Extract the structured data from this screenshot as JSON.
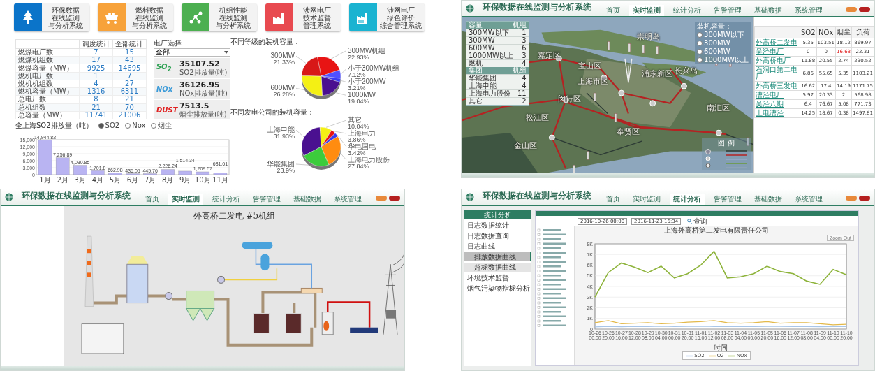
{
  "launcher": {
    "tiles": [
      {
        "lines": [
          "环保数据",
          "在线监测",
          "与分析系统"
        ],
        "color": "#0b74c9"
      },
      {
        "lines": [
          "燃料数据",
          "在线监测",
          "与分析系统"
        ],
        "color": "#f7a23a"
      },
      {
        "lines": [
          "机组性能",
          "在线监测",
          "与分析系统"
        ],
        "color": "#4caf50"
      },
      {
        "lines": [
          "涉网电厂",
          "技术监督",
          "管理系统"
        ],
        "color": "#e84a50"
      },
      {
        "lines": [
          "涉网电厂",
          "绿色评价",
          "综合管理系统"
        ],
        "color": "#1ab3d1"
      }
    ]
  },
  "overview": {
    "table": {
      "columns": [
        "调度统计",
        "全部统计"
      ],
      "rows": [
        {
          "label": "燃煤电厂数",
          "values": [
            "7",
            "15"
          ]
        },
        {
          "label": "燃煤机组数",
          "values": [
            "17",
            "43"
          ]
        },
        {
          "label": "燃煤容量（MW）",
          "values": [
            "9925",
            "14695"
          ]
        },
        {
          "label": "燃机电厂数",
          "values": [
            "1",
            "7"
          ]
        },
        {
          "label": "燃机机组数",
          "values": [
            "4",
            "27"
          ]
        },
        {
          "label": "燃机容量（MW）",
          "values": [
            "1316",
            "6311"
          ]
        },
        {
          "label": "总电厂数",
          "values": [
            "8",
            "21"
          ]
        },
        {
          "label": "总机组数",
          "values": [
            "21",
            "70"
          ]
        },
        {
          "label": "总容量（MW）",
          "values": [
            "11741",
            "21006"
          ]
        }
      ]
    },
    "plant_select": {
      "label": "电厂选择",
      "value": "全部"
    },
    "emissions": [
      {
        "kind": "so2",
        "badge": "SO$_{2}$",
        "value": "35107.52",
        "caption": "SO2排放量(吨)"
      },
      {
        "kind": "nox",
        "badge": "NOx",
        "value": "36126.95",
        "caption": "NOx排放量(吨)"
      },
      {
        "kind": "dust",
        "badge": "DUST",
        "value": "7513.5",
        "caption": "烟尘排放量(吨)"
      }
    ],
    "bar_chart": {
      "legend": [
        {
          "label": "SO2",
          "selected": true
        },
        {
          "label": "Nox",
          "selected": false
        },
        {
          "label": "烟尘",
          "selected": false
        }
      ],
      "chart_data": {
        "type": "bar",
        "title": "全上海SO2排放量（吨）",
        "categories": [
          "1月",
          "2月",
          "3月",
          "4月",
          "5月",
          "6月",
          "7月",
          "8月",
          "9月",
          "10月",
          "11月"
        ],
        "series": [
          {
            "color": "#b9b4f2",
            "values": [
              14944.82,
              7256.89,
              4030.85,
              1701.8,
              662.98,
              436.05,
              445.76,
              2226.24,
              1514.34,
              1209.57,
              681.61
            ]
          }
        ],
        "grid": true,
        "ylim": [
          0,
          15000
        ],
        "yticks": [
          0,
          {
            "value": 3000,
            "label": "3,000"
          },
          {
            "value": 6000,
            "label": "6,000"
          },
          {
            "value": 9000,
            "label": "9,000"
          },
          {
            "value": 12000,
            "label": "12,000"
          },
          {
            "value": 15000,
            "label": "15,000"
          }
        ],
        "value_labels": [
          "14,944.82",
          "7,256.89",
          "4,030.85",
          "1,701.8",
          "662.98",
          "436.05",
          "445.76",
          "2,226.24",
          "1,514.34",
          "1,209.57",
          "681.61"
        ]
      }
    },
    "pies": [
      {
        "chart_data": {
          "type": "pie",
          "title": "不同等级的装机容量：",
          "categories": [
            "300MW机组",
            "小于300MW机组",
            "小于200MW",
            "1000MW",
            "600MW",
            "300MW"
          ],
          "values": [
            22.93,
            7.12,
            3.21,
            19.04,
            26.28,
            21.33
          ],
          "value_labels": [
            "22.93%",
            "7.12%",
            "3.21%",
            "19.04%",
            "26.28%",
            "21.33%"
          ]
        }
      },
      {
        "chart_data": {
          "type": "pie",
          "title": "不同发电公司的装机容量：",
          "categories": [
            "上海申能",
            "其它",
            "上海电力",
            "华电国电",
            "上海电力股份",
            "华能集团"
          ],
          "values": [
            31.93,
            10.04,
            3.86,
            3.42,
            27.84,
            23.9
          ],
          "value_labels": [
            "31.93%",
            "10.04%",
            "3.86%",
            "3.42%",
            "27.84%",
            "23.9%"
          ]
        }
      }
    ]
  },
  "map_screen": {
    "header": {
      "title": "环保数据在线监测与分析系统",
      "nav": [
        {
          "label": "首页",
          "selected": false
        },
        {
          "label": "实时监测",
          "selected": true
        },
        {
          "label": "统计分析",
          "selected": false
        },
        {
          "label": "告警管理",
          "selected": false
        },
        {
          "label": "基础数据",
          "selected": false
        },
        {
          "label": "系统管理",
          "selected": false
        }
      ]
    },
    "overlay_table": [
      {
        "columns": [
          "容量",
          "机组"
        ],
        "rows": [
          [
            "300MW以下",
            "1"
          ],
          [
            "300MW",
            "3"
          ],
          [
            "600MW",
            "6"
          ],
          [
            "1000MW以上",
            "3"
          ],
          [
            "燃机",
            "4"
          ]
        ]
      },
      {
        "columns": [
          "集团",
          "机组"
        ],
        "rows": [
          [
            "华能集团",
            "4"
          ],
          [
            "上海申能",
            "4"
          ],
          [
            "上海电力股份",
            "11"
          ],
          [
            "其它",
            "2"
          ]
        ]
      }
    ],
    "capacity_legend": {
      "title": "装机容量：",
      "options": [
        {
          "label": "300MW以下",
          "selected": false
        },
        {
          "label": "300MW",
          "selected": false
        },
        {
          "label": "600MW",
          "selected": false
        },
        {
          "label": "1000MW以上",
          "selected": false
        }
      ]
    },
    "labels": [
      "崇明岛",
      "长兴岛",
      "宝山区",
      "嘉定区",
      "上海市区",
      "浦东新区",
      "闵行区",
      "松江区",
      "南汇区",
      "奉贤区",
      "金山区"
    ],
    "legend_title": "图 例",
    "plant_table": {
      "columns": [
        "SO2",
        "NOx",
        "烟尘",
        "负荷"
      ],
      "rows": [
        {
          "name": "外高桥二发电",
          "cells": [
            {
              "text": "5.35",
              "alert": false
            },
            {
              "text": "103.51",
              "alert": false
            },
            {
              "text": "18.12",
              "alert": false
            },
            {
              "text": "869.97",
              "alert": false
            }
          ]
        },
        {
          "name": "吴泾电厂",
          "cells": [
            {
              "text": "0",
              "alert": false
            },
            {
              "text": "0",
              "alert": false
            },
            {
              "text": "16.68",
              "alert": true
            },
            {
              "text": "22.31",
              "alert": false
            }
          ]
        },
        {
          "name": "外高桥电厂",
          "cells": [
            {
              "text": "11.88",
              "alert": false
            },
            {
              "text": "20.55",
              "alert": false
            },
            {
              "text": "2.74",
              "alert": false
            },
            {
              "text": "230.52",
              "alert": false
            }
          ]
        },
        {
          "name": "石洞口第二电厂",
          "cells": [
            {
              "text": "6.86",
              "alert": false
            },
            {
              "text": "55.65",
              "alert": false
            },
            {
              "text": "5.35",
              "alert": false
            },
            {
              "text": "1103.21",
              "alert": false
            }
          ]
        },
        {
          "name": "外高桥三发电",
          "cells": [
            {
              "text": "16.62",
              "alert": false
            },
            {
              "text": "17.4",
              "alert": false
            },
            {
              "text": "14.19",
              "alert": false
            },
            {
              "text": "1171.75",
              "alert": false
            }
          ]
        },
        {
          "name": "漕泾电厂",
          "cells": [
            {
              "text": "5.97",
              "alert": false
            },
            {
              "text": "20.33",
              "alert": false
            },
            {
              "text": "2",
              "alert": false
            },
            {
              "text": "568.98",
              "alert": false
            }
          ]
        },
        {
          "name": "吴泾八期",
          "cells": [
            {
              "text": "6.4",
              "alert": false
            },
            {
              "text": "76.67",
              "alert": false
            },
            {
              "text": "5.08",
              "alert": false
            },
            {
              "text": "771.73",
              "alert": false
            }
          ]
        },
        {
          "name": "上电漕泾",
          "cells": [
            {
              "text": "14.25",
              "alert": false
            },
            {
              "text": "18.67",
              "alert": false
            },
            {
              "text": "0.38",
              "alert": false
            },
            {
              "text": "1497.81",
              "alert": false
            }
          ]
        }
      ]
    }
  },
  "process_screen": {
    "header": {
      "title": "环保数据在线监测与分析系统",
      "nav": [
        {
          "label": "首页",
          "selected": false
        },
        {
          "label": "实时监测",
          "selected": true
        },
        {
          "label": "统计分析",
          "selected": false
        },
        {
          "label": "告警管理",
          "selected": false
        },
        {
          "label": "基础数据",
          "selected": false
        },
        {
          "label": "系统管理",
          "selected": false
        }
      ]
    },
    "title": "外高桥二发电 #5机组"
  },
  "stats_screen": {
    "header": {
      "title": "环保数据在线监测与分析系统",
      "nav": [
        {
          "label": "首页",
          "selected": false
        },
        {
          "label": "实时监测",
          "selected": false
        },
        {
          "label": "统计分析",
          "selected": true
        },
        {
          "label": "告警管理",
          "selected": false
        },
        {
          "label": "基础数据",
          "selected": false
        },
        {
          "label": "系统管理",
          "selected": false
        }
      ]
    },
    "sidebar": {
      "title": "统计分析",
      "items": [
        {
          "label": "日志数据统计",
          "selected": false
        },
        {
          "label": "日志数据查询",
          "selected": false
        },
        {
          "label": "日志曲线",
          "selected": false,
          "children": [
            {
              "label": "排放数据曲线",
              "selected": true
            },
            {
              "label": "超标数据曲线",
              "selected": false
            }
          ]
        },
        {
          "label": "环境技术监督",
          "selected": false
        },
        {
          "label": "烟气污染物指标分析",
          "selected": false
        }
      ]
    },
    "query": {
      "start": "2016-10-26 00:00",
      "end": "2016-11-23 16:34",
      "search_button": "查询"
    },
    "chart": {
      "title": "上海外高桥第二发电有限责任公司",
      "zoom_button": "Zoom Out",
      "chart_data": {
        "type": "line",
        "xlabel": "时间",
        "categories": [
          "10-26 00:00",
          "10-26 20:00",
          "10-27 16:00",
          "10-28 12:00",
          "10-29 08:00",
          "10-30 04:00",
          "10-31 00:00",
          "10-31 20:00",
          "11-01 16:00",
          "11-02 12:00",
          "11-03 08:00",
          "11-04 04:00",
          "11-05 00:00",
          "11-05 20:00",
          "11-06 16:00",
          "11-07 12:00",
          "11-08 08:00",
          "11-09 04:00",
          "11-10 00:00",
          "11-10 20:00"
        ],
        "series": [
          {
            "name": "SO2",
            "color": "#a9c6e8",
            "values": [
              200,
              250,
              220,
              260,
              240,
              270,
              230,
              250,
              260,
              240,
              230,
              250,
              240,
              260,
              250,
              240,
              230,
              220,
              240,
              230
            ]
          },
          {
            "name": "O2",
            "color": "#e3b94a",
            "values": [
              600,
              800,
              500,
              550,
              600,
              500,
              550,
              650,
              700,
              800,
              600,
              550,
              600,
              700,
              550,
              600,
              600,
              500,
              400,
              450
            ]
          },
          {
            "name": "NOx",
            "color": "#8db33a",
            "values": [
              3000,
              5300,
              6200,
              5800,
              5300,
              5900,
              4800,
              5200,
              6000,
              7300,
              4800,
              4900,
              5200,
              5900,
              5400,
              5200,
              4500,
              4200,
              5600,
              5100
            ]
          }
        ],
        "grid": true,
        "ylim": [
          0,
          8000
        ],
        "yticks": [
          0,
          {
            "value": 1000,
            "label": "1K"
          },
          {
            "value": 2000,
            "label": "2K"
          },
          {
            "value": 3000,
            "label": "3K"
          },
          {
            "value": 4000,
            "label": "4K"
          },
          {
            "value": 5000,
            "label": "5K"
          },
          {
            "value": 6000,
            "label": "6K"
          },
          {
            "value": 7000,
            "label": "7K"
          },
          {
            "value": 8000,
            "label": "8K"
          }
        ]
      }
    }
  }
}
